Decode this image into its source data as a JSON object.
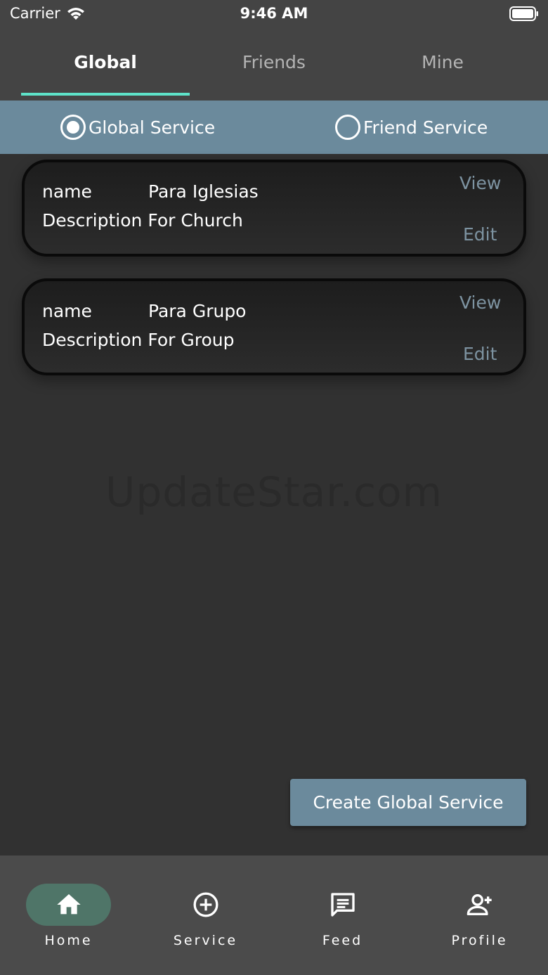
{
  "status_bar": {
    "carrier": "Carrier",
    "time": "9:46 AM"
  },
  "tabs": [
    {
      "label": "Global",
      "active": true
    },
    {
      "label": "Friends",
      "active": false
    },
    {
      "label": "Mine",
      "active": false
    }
  ],
  "service_filter": {
    "options": [
      {
        "label": "Global Service",
        "selected": true
      },
      {
        "label": "Friend Service",
        "selected": false
      }
    ]
  },
  "cards": [
    {
      "name_label": "name",
      "name_value": "Para Iglesias",
      "description": "Description For Church",
      "view_label": "View",
      "edit_label": "Edit"
    },
    {
      "name_label": "name",
      "name_value": "Para Grupo",
      "description": "Description For Group",
      "view_label": "View",
      "edit_label": "Edit"
    }
  ],
  "watermark": "UpdateStar.com",
  "create_button_label": "Create Global Service",
  "bottom_nav": [
    {
      "label": "Home",
      "icon": "home-icon",
      "active": true
    },
    {
      "label": "Service",
      "icon": "plus-circle-icon",
      "active": false
    },
    {
      "label": "Feed",
      "icon": "chat-icon",
      "active": false
    },
    {
      "label": "Profile",
      "icon": "add-user-icon",
      "active": false
    }
  ],
  "colors": {
    "background": "#313131",
    "bar": "#444444",
    "accent": "#5ee3c9",
    "service_bar": "#6b8a9c",
    "link": "#7d93a1",
    "home_pill": "#4f7568"
  }
}
